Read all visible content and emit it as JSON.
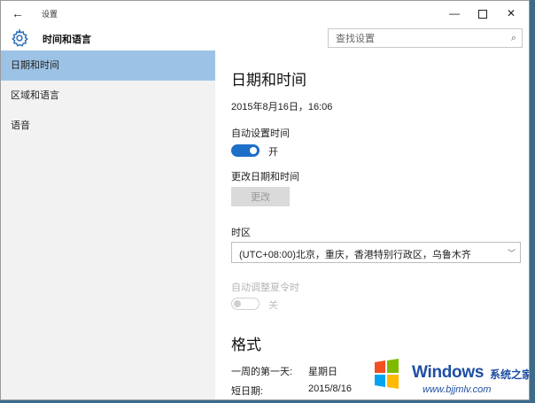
{
  "window": {
    "title": "设置",
    "back_glyph": "←",
    "minimize_glyph": "—",
    "close_glyph": "✕"
  },
  "header": {
    "app_title": "时间和语言",
    "search_placeholder": "查找设置",
    "search_icon": "search-icon"
  },
  "sidebar": {
    "items": [
      {
        "label": "日期和时间",
        "active": true
      },
      {
        "label": "区域和语言",
        "active": false
      },
      {
        "label": "语音",
        "active": false
      }
    ]
  },
  "main": {
    "title": "日期和时间",
    "current_datetime": "2015年8月16日，16:06",
    "auto_time": {
      "label": "自动设置时间",
      "state": "开",
      "on": true
    },
    "change_datetime": {
      "label": "更改日期和时间",
      "button": "更改",
      "enabled": false
    },
    "timezone": {
      "label": "时区",
      "value": "(UTC+08:00)北京，重庆，香港特别行政区，乌鲁木齐",
      "chevron": "﹀"
    },
    "dst": {
      "label": "自动调整夏令时",
      "state": "关",
      "on": false,
      "enabled": false
    },
    "formats": {
      "title": "格式",
      "rows": [
        {
          "key": "一周的第一天:",
          "value": "星期日"
        },
        {
          "key": "短日期:",
          "value": "2015/8/16"
        }
      ]
    }
  },
  "watermark": {
    "brand": "Windows",
    "cn": "系统之家",
    "url": "www.bjjmlv.com"
  },
  "colors": {
    "accent": "#1e6fc7",
    "sidebar_active": "#9cc3e6",
    "sidebar_bg": "#f2f2f2",
    "disabled": "#b5b5b5"
  }
}
